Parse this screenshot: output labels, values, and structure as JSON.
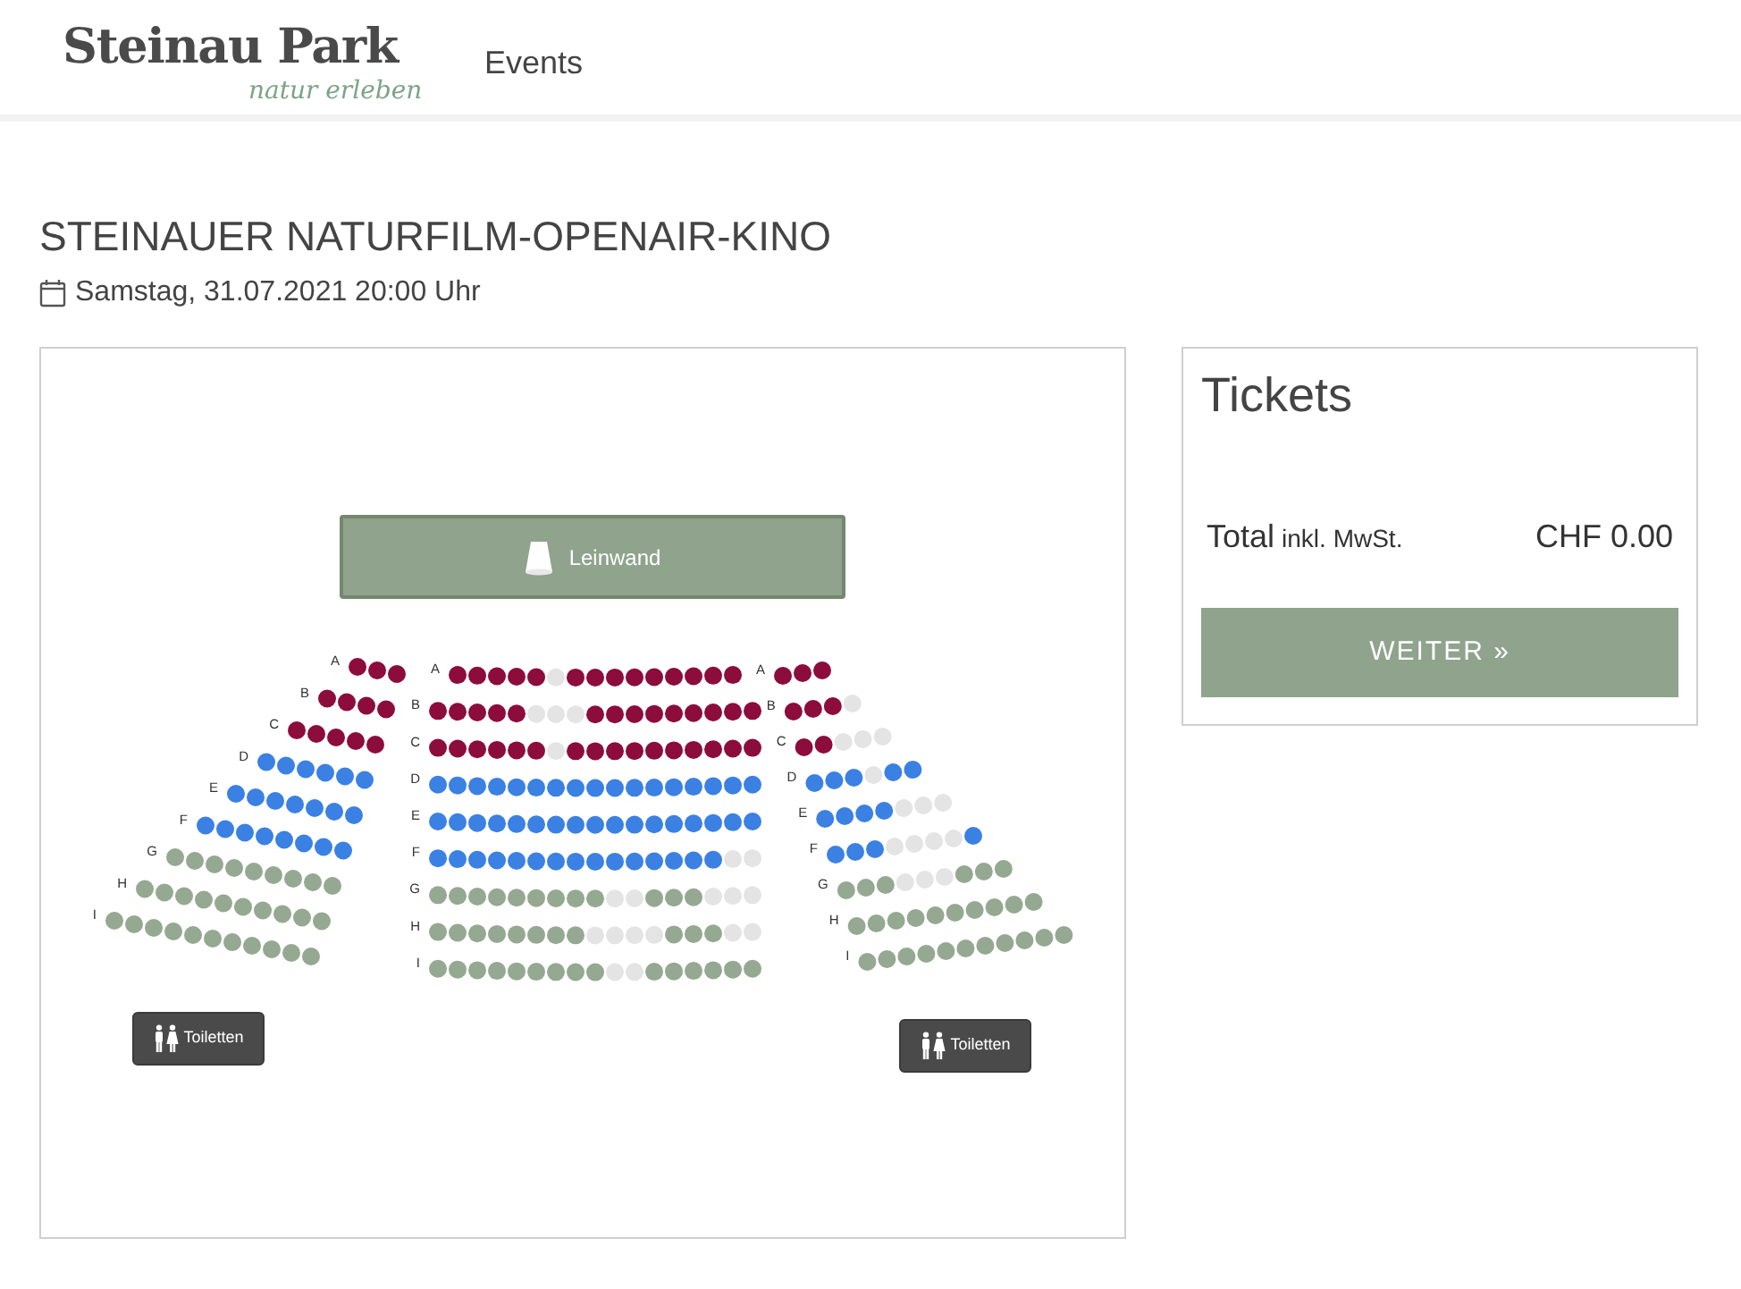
{
  "header": {
    "logo": {
      "name": "Steinau Park",
      "tagline": "natur erleben"
    },
    "nav": [
      {
        "label": "Events"
      }
    ]
  },
  "event": {
    "title": "STEINAUER NATURFILM-OPENAIR-KINO",
    "date": "Samstag, 31.07.2021 20:00 Uhr"
  },
  "seat_map": {
    "screen": {
      "label": "Leinwand"
    },
    "sections": [
      {
        "kind": "left",
        "rows": [
          {
            "label": "A",
            "seats": [
              {
                "color": "#8c0c3c"
              },
              {
                "color": "#8c0c3c"
              },
              {
                "color": "#8c0c3c"
              }
            ]
          },
          {
            "label": "B",
            "seats": [
              {
                "color": "#8c0c3c"
              },
              {
                "color": "#8c0c3c"
              },
              {
                "color": "#8c0c3c"
              },
              {
                "color": "#8c0c3c"
              }
            ]
          },
          {
            "label": "C",
            "seats": [
              {
                "color": "#8c0c3c"
              },
              {
                "color": "#8c0c3c"
              },
              {
                "color": "#8c0c3c"
              },
              {
                "color": "#8c0c3c"
              },
              {
                "color": "#8c0c3c"
              }
            ]
          },
          {
            "label": "D",
            "seats": [
              {
                "color": "#3b80e3"
              },
              {
                "color": "#3b80e3"
              },
              {
                "color": "#3b80e3"
              },
              {
                "color": "#3b80e3"
              },
              {
                "color": "#3b80e3"
              },
              {
                "color": "#3b80e3"
              }
            ]
          },
          {
            "label": "E",
            "seats": [
              {
                "color": "#3b80e3"
              },
              {
                "color": "#3b80e3"
              },
              {
                "color": "#3b80e3"
              },
              {
                "color": "#3b80e3"
              },
              {
                "color": "#3b80e3"
              },
              {
                "color": "#3b80e3"
              },
              {
                "color": "#3b80e3"
              }
            ]
          },
          {
            "label": "F",
            "seats": [
              {
                "color": "#3b80e3"
              },
              {
                "color": "#3b80e3"
              },
              {
                "color": "#3b80e3"
              },
              {
                "color": "#3b80e3"
              },
              {
                "color": "#3b80e3"
              },
              {
                "color": "#3b80e3"
              },
              {
                "color": "#3b80e3"
              },
              {
                "color": "#3b80e3"
              }
            ]
          },
          {
            "label": "G",
            "seats": [
              {
                "color": "#95a891"
              },
              {
                "color": "#95a891"
              },
              {
                "color": "#95a891"
              },
              {
                "color": "#95a891"
              },
              {
                "color": "#95a891"
              },
              {
                "color": "#95a891"
              },
              {
                "color": "#95a891"
              },
              {
                "color": "#95a891"
              },
              {
                "color": "#95a891"
              }
            ]
          },
          {
            "label": "H",
            "seats": [
              {
                "color": "#95a891"
              },
              {
                "color": "#95a891"
              },
              {
                "color": "#95a891"
              },
              {
                "color": "#95a891"
              },
              {
                "color": "#95a891"
              },
              {
                "color": "#95a891"
              },
              {
                "color": "#95a891"
              },
              {
                "color": "#95a891"
              },
              {
                "color": "#95a891"
              },
              {
                "color": "#95a891"
              }
            ]
          },
          {
            "label": "I",
            "seats": [
              {
                "color": "#95a891"
              },
              {
                "color": "#95a891"
              },
              {
                "color": "#95a891"
              },
              {
                "color": "#95a891"
              },
              {
                "color": "#95a891"
              },
              {
                "color": "#95a891"
              },
              {
                "color": "#95a891"
              },
              {
                "color": "#95a891"
              },
              {
                "color": "#95a891"
              },
              {
                "color": "#95a891"
              },
              {
                "color": "#95a891"
              }
            ]
          }
        ]
      },
      {
        "kind": "center",
        "rows": [
          {
            "label": "A",
            "seats": [
              {
                "color": "#8c0c3c"
              },
              {
                "color": "#8c0c3c"
              },
              {
                "color": "#8c0c3c"
              },
              {
                "color": "#8c0c3c"
              },
              {
                "color": "#8c0c3c"
              },
              {
                "color": "#e4e4e4"
              },
              {
                "color": "#8c0c3c"
              },
              {
                "color": "#8c0c3c"
              },
              {
                "color": "#8c0c3c"
              },
              {
                "color": "#8c0c3c"
              },
              {
                "color": "#8c0c3c"
              },
              {
                "color": "#8c0c3c"
              },
              {
                "color": "#8c0c3c"
              },
              {
                "color": "#8c0c3c"
              },
              {
                "color": "#8c0c3c"
              }
            ]
          },
          {
            "label": "B",
            "seats": [
              {
                "color": "#8c0c3c"
              },
              {
                "color": "#8c0c3c"
              },
              {
                "color": "#8c0c3c"
              },
              {
                "color": "#8c0c3c"
              },
              {
                "color": "#8c0c3c"
              },
              {
                "color": "#e4e4e4"
              },
              {
                "color": "#e4e4e4"
              },
              {
                "color": "#e4e4e4"
              },
              {
                "color": "#8c0c3c"
              },
              {
                "color": "#8c0c3c"
              },
              {
                "color": "#8c0c3c"
              },
              {
                "color": "#8c0c3c"
              },
              {
                "color": "#8c0c3c"
              },
              {
                "color": "#8c0c3c"
              },
              {
                "color": "#8c0c3c"
              },
              {
                "color": "#8c0c3c"
              },
              {
                "color": "#8c0c3c"
              }
            ]
          },
          {
            "label": "C",
            "seats": [
              {
                "color": "#8c0c3c"
              },
              {
                "color": "#8c0c3c"
              },
              {
                "color": "#8c0c3c"
              },
              {
                "color": "#8c0c3c"
              },
              {
                "color": "#8c0c3c"
              },
              {
                "color": "#8c0c3c"
              },
              {
                "color": "#e4e4e4"
              },
              {
                "color": "#8c0c3c"
              },
              {
                "color": "#8c0c3c"
              },
              {
                "color": "#8c0c3c"
              },
              {
                "color": "#8c0c3c"
              },
              {
                "color": "#8c0c3c"
              },
              {
                "color": "#8c0c3c"
              },
              {
                "color": "#8c0c3c"
              },
              {
                "color": "#8c0c3c"
              },
              {
                "color": "#8c0c3c"
              },
              {
                "color": "#8c0c3c"
              }
            ]
          },
          {
            "label": "D",
            "seats": [
              {
                "color": "#3b80e3"
              },
              {
                "color": "#3b80e3"
              },
              {
                "color": "#3b80e3"
              },
              {
                "color": "#3b80e3"
              },
              {
                "color": "#3b80e3"
              },
              {
                "color": "#3b80e3"
              },
              {
                "color": "#3b80e3"
              },
              {
                "color": "#3b80e3"
              },
              {
                "color": "#3b80e3"
              },
              {
                "color": "#3b80e3"
              },
              {
                "color": "#3b80e3"
              },
              {
                "color": "#3b80e3"
              },
              {
                "color": "#3b80e3"
              },
              {
                "color": "#3b80e3"
              },
              {
                "color": "#3b80e3"
              },
              {
                "color": "#3b80e3"
              },
              {
                "color": "#3b80e3"
              }
            ]
          },
          {
            "label": "E",
            "seats": [
              {
                "color": "#3b80e3"
              },
              {
                "color": "#3b80e3"
              },
              {
                "color": "#3b80e3"
              },
              {
                "color": "#3b80e3"
              },
              {
                "color": "#3b80e3"
              },
              {
                "color": "#3b80e3"
              },
              {
                "color": "#3b80e3"
              },
              {
                "color": "#3b80e3"
              },
              {
                "color": "#3b80e3"
              },
              {
                "color": "#3b80e3"
              },
              {
                "color": "#3b80e3"
              },
              {
                "color": "#3b80e3"
              },
              {
                "color": "#3b80e3"
              },
              {
                "color": "#3b80e3"
              },
              {
                "color": "#3b80e3"
              },
              {
                "color": "#3b80e3"
              },
              {
                "color": "#3b80e3"
              }
            ]
          },
          {
            "label": "F",
            "seats": [
              {
                "color": "#3b80e3"
              },
              {
                "color": "#3b80e3"
              },
              {
                "color": "#3b80e3"
              },
              {
                "color": "#3b80e3"
              },
              {
                "color": "#3b80e3"
              },
              {
                "color": "#3b80e3"
              },
              {
                "color": "#3b80e3"
              },
              {
                "color": "#3b80e3"
              },
              {
                "color": "#3b80e3"
              },
              {
                "color": "#3b80e3"
              },
              {
                "color": "#3b80e3"
              },
              {
                "color": "#3b80e3"
              },
              {
                "color": "#3b80e3"
              },
              {
                "color": "#3b80e3"
              },
              {
                "color": "#3b80e3"
              },
              {
                "color": "#e4e4e4"
              },
              {
                "color": "#e4e4e4"
              }
            ]
          },
          {
            "label": "G",
            "seats": [
              {
                "color": "#95a891"
              },
              {
                "color": "#95a891"
              },
              {
                "color": "#95a891"
              },
              {
                "color": "#95a891"
              },
              {
                "color": "#95a891"
              },
              {
                "color": "#95a891"
              },
              {
                "color": "#95a891"
              },
              {
                "color": "#95a891"
              },
              {
                "color": "#95a891"
              },
              {
                "color": "#e4e4e4"
              },
              {
                "color": "#e4e4e4"
              },
              {
                "color": "#95a891"
              },
              {
                "color": "#95a891"
              },
              {
                "color": "#95a891"
              },
              {
                "color": "#e4e4e4"
              },
              {
                "color": "#e4e4e4"
              },
              {
                "color": "#e4e4e4"
              }
            ]
          },
          {
            "label": "H",
            "seats": [
              {
                "color": "#95a891"
              },
              {
                "color": "#95a891"
              },
              {
                "color": "#95a891"
              },
              {
                "color": "#95a891"
              },
              {
                "color": "#95a891"
              },
              {
                "color": "#95a891"
              },
              {
                "color": "#95a891"
              },
              {
                "color": "#95a891"
              },
              {
                "color": "#e4e4e4"
              },
              {
                "color": "#e4e4e4"
              },
              {
                "color": "#e4e4e4"
              },
              {
                "color": "#e4e4e4"
              },
              {
                "color": "#95a891"
              },
              {
                "color": "#95a891"
              },
              {
                "color": "#95a891"
              },
              {
                "color": "#e4e4e4"
              },
              {
                "color": "#e4e4e4"
              }
            ]
          },
          {
            "label": "I",
            "seats": [
              {
                "color": "#95a891"
              },
              {
                "color": "#95a891"
              },
              {
                "color": "#95a891"
              },
              {
                "color": "#95a891"
              },
              {
                "color": "#95a891"
              },
              {
                "color": "#95a891"
              },
              {
                "color": "#95a891"
              },
              {
                "color": "#95a891"
              },
              {
                "color": "#95a891"
              },
              {
                "color": "#e4e4e4"
              },
              {
                "color": "#e4e4e4"
              },
              {
                "color": "#95a891"
              },
              {
                "color": "#95a891"
              },
              {
                "color": "#95a891"
              },
              {
                "color": "#95a891"
              },
              {
                "color": "#95a891"
              },
              {
                "color": "#95a891"
              }
            ]
          }
        ]
      },
      {
        "kind": "right",
        "rows": [
          {
            "label": "A",
            "seats": [
              {
                "color": "#8c0c3c"
              },
              {
                "color": "#8c0c3c"
              },
              {
                "color": "#8c0c3c"
              }
            ]
          },
          {
            "label": "B",
            "seats": [
              {
                "color": "#8c0c3c"
              },
              {
                "color": "#8c0c3c"
              },
              {
                "color": "#8c0c3c"
              },
              {
                "color": "#e4e4e4"
              }
            ]
          },
          {
            "label": "C",
            "seats": [
              {
                "color": "#8c0c3c"
              },
              {
                "color": "#8c0c3c"
              },
              {
                "color": "#e4e4e4"
              },
              {
                "color": "#e4e4e4"
              },
              {
                "color": "#e4e4e4"
              }
            ]
          },
          {
            "label": "D",
            "seats": [
              {
                "color": "#3b80e3"
              },
              {
                "color": "#3b80e3"
              },
              {
                "color": "#3b80e3"
              },
              {
                "color": "#e4e4e4"
              },
              {
                "color": "#3b80e3"
              },
              {
                "color": "#3b80e3"
              }
            ]
          },
          {
            "label": "E",
            "seats": [
              {
                "color": "#3b80e3"
              },
              {
                "color": "#3b80e3"
              },
              {
                "color": "#3b80e3"
              },
              {
                "color": "#3b80e3"
              },
              {
                "color": "#e4e4e4"
              },
              {
                "color": "#e4e4e4"
              },
              {
                "color": "#e4e4e4"
              }
            ]
          },
          {
            "label": "F",
            "seats": [
              {
                "color": "#3b80e3"
              },
              {
                "color": "#3b80e3"
              },
              {
                "color": "#3b80e3"
              },
              {
                "color": "#e4e4e4"
              },
              {
                "color": "#e4e4e4"
              },
              {
                "color": "#e4e4e4"
              },
              {
                "color": "#e4e4e4"
              },
              {
                "color": "#3b80e3"
              }
            ]
          },
          {
            "label": "G",
            "seats": [
              {
                "color": "#95a891"
              },
              {
                "color": "#95a891"
              },
              {
                "color": "#95a891"
              },
              {
                "color": "#e4e4e4"
              },
              {
                "color": "#e4e4e4"
              },
              {
                "color": "#e4e4e4"
              },
              {
                "color": "#95a891"
              },
              {
                "color": "#95a891"
              },
              {
                "color": "#95a891"
              }
            ]
          },
          {
            "label": "H",
            "seats": [
              {
                "color": "#95a891"
              },
              {
                "color": "#95a891"
              },
              {
                "color": "#95a891"
              },
              {
                "color": "#95a891"
              },
              {
                "color": "#95a891"
              },
              {
                "color": "#95a891"
              },
              {
                "color": "#95a891"
              },
              {
                "color": "#95a891"
              },
              {
                "color": "#95a891"
              },
              {
                "color": "#95a891"
              }
            ]
          },
          {
            "label": "I",
            "seats": [
              {
                "color": "#95a891"
              },
              {
                "color": "#95a891"
              },
              {
                "color": "#95a891"
              },
              {
                "color": "#95a891"
              },
              {
                "color": "#95a891"
              },
              {
                "color": "#95a891"
              },
              {
                "color": "#95a891"
              },
              {
                "color": "#95a891"
              },
              {
                "color": "#95a891"
              },
              {
                "color": "#95a891"
              },
              {
                "color": "#95a891"
              }
            ]
          }
        ]
      }
    ],
    "toilets": [
      {
        "label": "Toiletten"
      },
      {
        "label": "Toiletten"
      }
    ]
  },
  "tickets": {
    "title": "Tickets",
    "total_label": "Total",
    "total_note": "inkl. MwSt.",
    "total_value": "CHF 0.00",
    "button": "WEITER »"
  }
}
